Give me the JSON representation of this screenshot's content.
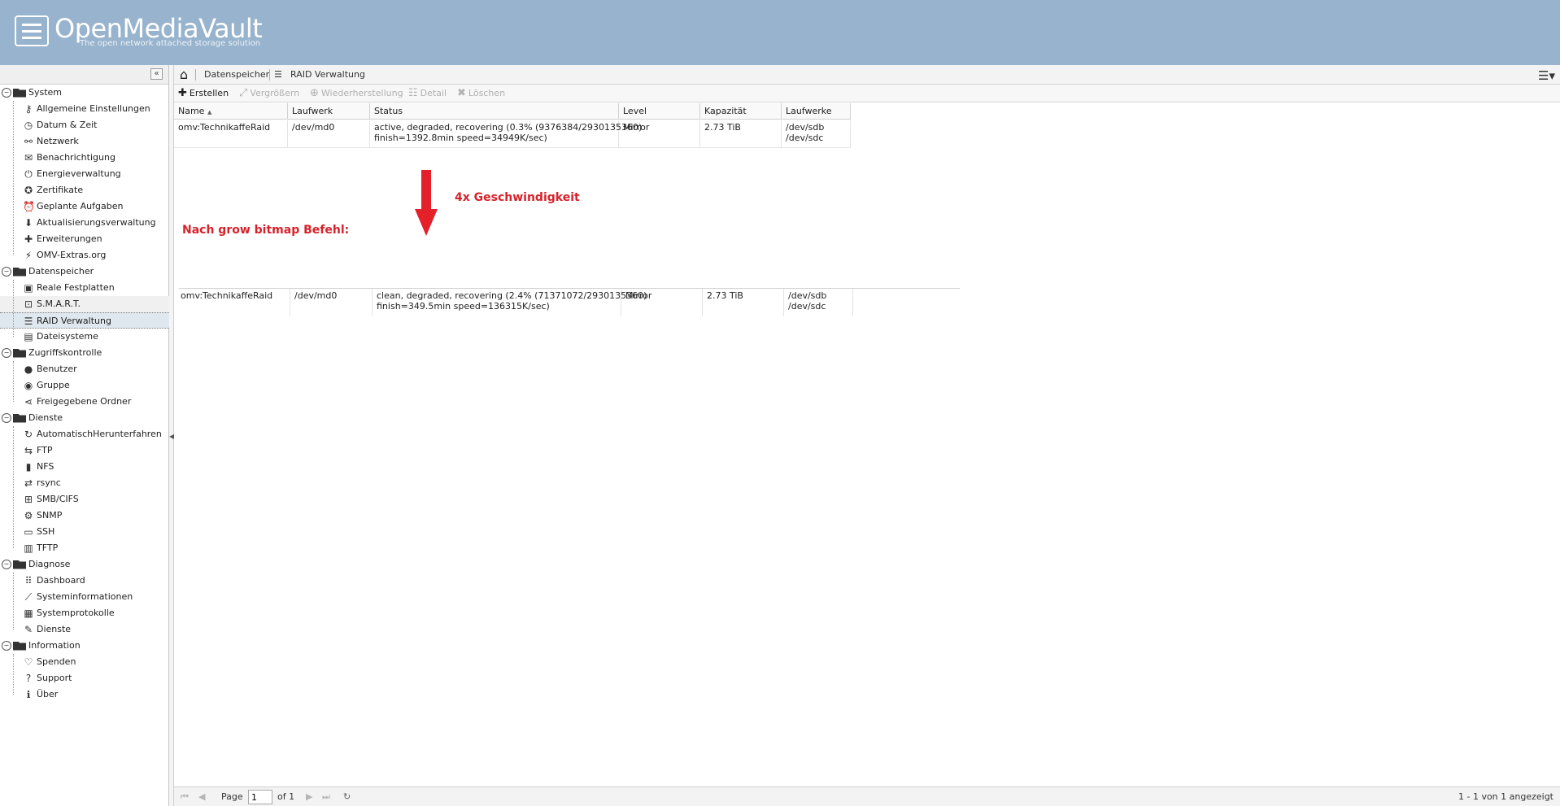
{
  "header": {
    "title": "OpenMediaVault",
    "subtitle": "The open network attached storage solution"
  },
  "sidebar": {
    "collapse_icon": "«",
    "groups": [
      {
        "label": "System",
        "items": [
          {
            "label": "Allgemeine Einstellungen",
            "icon": "key-icon",
            "glyph": "⚷"
          },
          {
            "label": "Datum & Zeit",
            "icon": "clock-icon",
            "glyph": "◷"
          },
          {
            "label": "Netzwerk",
            "icon": "network-icon",
            "glyph": "⚯"
          },
          {
            "label": "Benachrichtigung",
            "icon": "envelope-icon",
            "glyph": "✉"
          },
          {
            "label": "Energieverwaltung",
            "icon": "power-icon",
            "glyph": "⏻"
          },
          {
            "label": "Zertifikate",
            "icon": "certificate-icon",
            "glyph": "✪"
          },
          {
            "label": "Geplante Aufgaben",
            "icon": "alarm-icon",
            "glyph": "⏰"
          },
          {
            "label": "Aktualisierungsverwaltung",
            "icon": "update-icon",
            "glyph": "⬇"
          },
          {
            "label": "Erweiterungen",
            "icon": "puzzle-icon",
            "glyph": "✚"
          },
          {
            "label": "OMV-Extras.org",
            "icon": "plug-icon",
            "glyph": "⚡"
          }
        ]
      },
      {
        "label": "Datenspeicher",
        "items": [
          {
            "label": "Reale Festplatten",
            "icon": "disk-icon",
            "glyph": "▣"
          },
          {
            "label": "S.M.A.R.T.",
            "icon": "smart-icon",
            "glyph": "⊡"
          },
          {
            "label": "RAID Verwaltung",
            "icon": "raid-icon",
            "glyph": "☰"
          },
          {
            "label": "Dateisysteme",
            "icon": "filesystem-icon",
            "glyph": "▤"
          }
        ]
      },
      {
        "label": "Zugriffskontrolle",
        "items": [
          {
            "label": "Benutzer",
            "icon": "user-icon",
            "glyph": "●"
          },
          {
            "label": "Gruppe",
            "icon": "group-icon",
            "glyph": "◉"
          },
          {
            "label": "Freigegebene Ordner",
            "icon": "share-icon",
            "glyph": "⋖"
          }
        ]
      },
      {
        "label": "Dienste",
        "items": [
          {
            "label": "AutomatischHerunterfahren",
            "icon": "auto-shutdown-icon",
            "glyph": "↻"
          },
          {
            "label": "FTP",
            "icon": "ftp-icon",
            "glyph": "⇆"
          },
          {
            "label": "NFS",
            "icon": "nfs-icon",
            "glyph": "▮"
          },
          {
            "label": "rsync",
            "icon": "rsync-icon",
            "glyph": "⇄"
          },
          {
            "label": "SMB/CIFS",
            "icon": "windows-icon",
            "glyph": "⊞"
          },
          {
            "label": "SNMP",
            "icon": "snmp-icon",
            "glyph": "⚙"
          },
          {
            "label": "SSH",
            "icon": "terminal-icon",
            "glyph": "▭"
          },
          {
            "label": "TFTP",
            "icon": "tftp-icon",
            "glyph": "▥"
          }
        ]
      },
      {
        "label": "Diagnose",
        "items": [
          {
            "label": "Dashboard",
            "icon": "dashboard-icon",
            "glyph": "⠿"
          },
          {
            "label": "Systeminformationen",
            "icon": "chart-icon",
            "glyph": "⟋"
          },
          {
            "label": "Systemprotokolle",
            "icon": "log-icon",
            "glyph": "▦"
          },
          {
            "label": "Dienste",
            "icon": "wrench-icon",
            "glyph": "✎"
          }
        ]
      },
      {
        "label": "Information",
        "items": [
          {
            "label": "Spenden",
            "icon": "heart-icon",
            "glyph": "♡"
          },
          {
            "label": "Support",
            "icon": "question-icon",
            "glyph": "?"
          },
          {
            "label": "Über",
            "icon": "info-icon",
            "glyph": "ℹ"
          }
        ]
      }
    ]
  },
  "breadcrumb": {
    "items": [
      "Datenspeicher",
      "RAID Verwaltung"
    ]
  },
  "toolbar": {
    "create": "Erstellen",
    "grow": "Vergrößern",
    "recover": "Wiederherstellung",
    "detail": "Detail",
    "delete": "Löschen"
  },
  "grid": {
    "columns": [
      "Name",
      "Laufwerk",
      "Status",
      "Level",
      "Kapazität",
      "Laufwerke"
    ],
    "sort_indicator": "▲",
    "rows": [
      {
        "name": "omv:TechnikaffeRaid",
        "device": "/dev/md0",
        "status_line1": "active, degraded, recovering (0.3% (9376384/2930135360)",
        "status_line2": "finish=1392.8min speed=34949K/sec)",
        "level": "Mirror",
        "capacity": "2.73 TiB",
        "disk1": "/dev/sdb",
        "disk2": "/dev/sdc"
      }
    ]
  },
  "annotations": {
    "speed": "4x Geschwindigkeit",
    "after": "Nach grow bitmap Befehl:",
    "arrow_color": "#e4202a",
    "text_color": "#d6222a"
  },
  "grid2": {
    "rows": [
      {
        "name": "omv:TechnikaffeRaid",
        "device": "/dev/md0",
        "status_line1": "clean, degraded, recovering (2.4% (71371072/2930135360)",
        "status_line2": "finish=349.5min speed=136315K/sec)",
        "level": "Mirror",
        "capacity": "2.73 TiB",
        "disk1": "/dev/sdb",
        "disk2": "/dev/sdc"
      }
    ]
  },
  "paging": {
    "page_label": "Page",
    "page_value": "1",
    "of_label": "of 1",
    "summary": "1 - 1 von 1 angezeigt"
  },
  "colors": {
    "header_bg": "#97b3cd",
    "selected_bg": "#dfe7ef"
  }
}
